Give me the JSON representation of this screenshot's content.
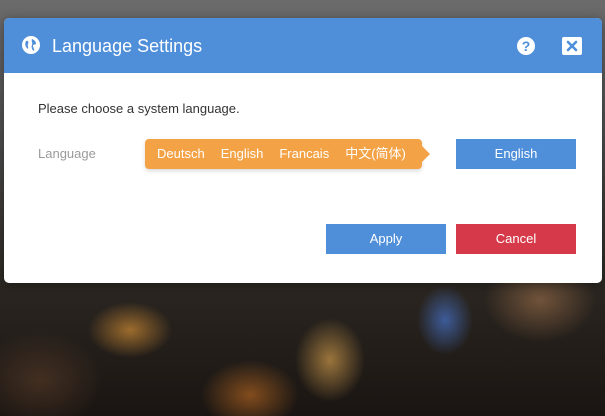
{
  "dialog": {
    "title": "Language Settings",
    "title_icon": "globe-icon",
    "help_icon": "help-icon",
    "close_icon": "close-icon",
    "prompt": "Please choose a system language.",
    "field_label": "Language",
    "language_options": [
      "Deutsch",
      "English",
      "Francais",
      "中文(简体)"
    ],
    "selected_language": "English",
    "apply_label": "Apply",
    "cancel_label": "Cancel"
  },
  "colors": {
    "titlebar": "#4f8fda",
    "popover": "#f4a246",
    "apply": "#4f8fda",
    "cancel": "#d63a4a"
  }
}
